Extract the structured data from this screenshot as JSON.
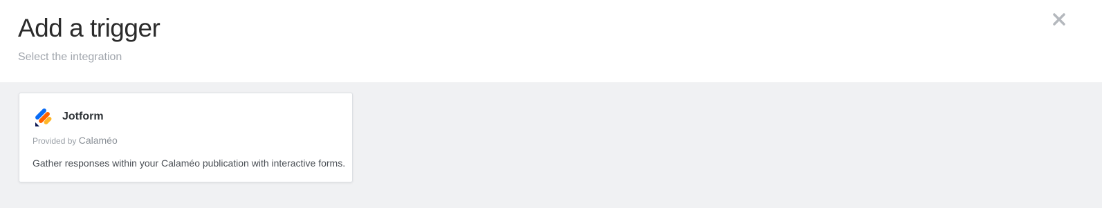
{
  "header": {
    "title": "Add a trigger",
    "subtitle": "Select the integration",
    "close_icon": "close-icon"
  },
  "integrations": [
    {
      "name": "Jotform",
      "icon": "jotform-logo-icon",
      "provided_by_label": "Provided by",
      "provider": "Calaméo",
      "description": "Gather responses within your Calaméo publication with interactive forms."
    }
  ],
  "colors": {
    "background": "#f0f1f3",
    "card_bg": "#ffffff",
    "title": "#2b2b2b",
    "subtitle": "#a1a6ad",
    "jotform_blue": "#0a6cf5",
    "jotform_orange": "#ff6100",
    "jotform_yellow": "#ffb629",
    "jotform_navy": "#0a1551"
  }
}
